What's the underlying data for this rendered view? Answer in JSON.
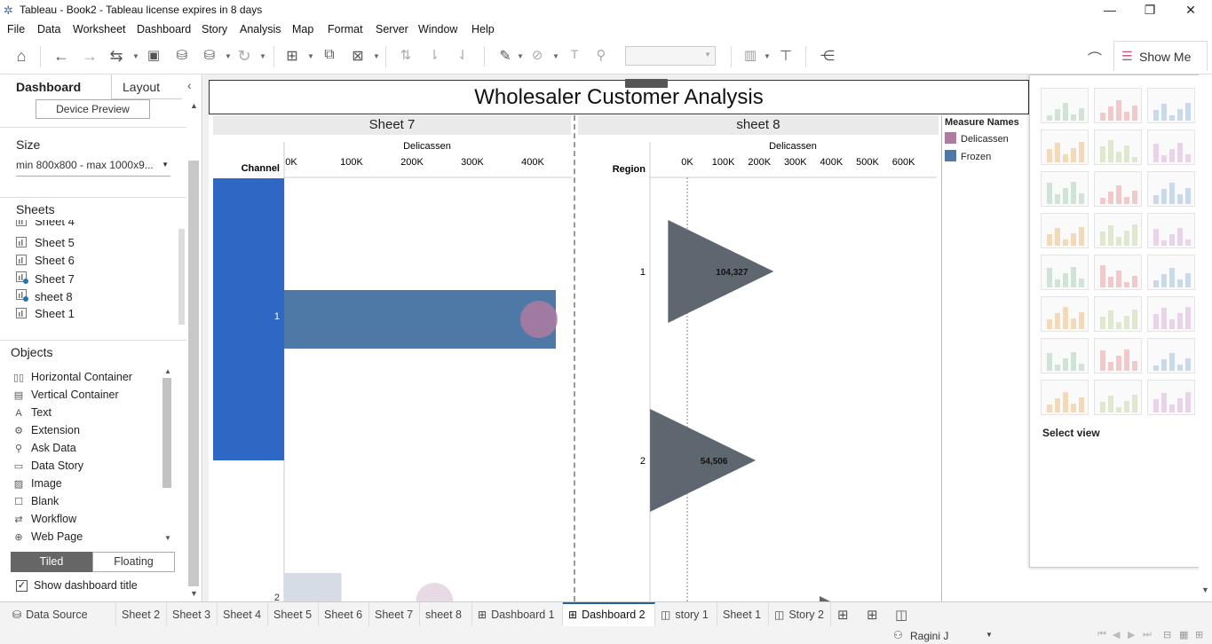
{
  "window": {
    "title": "Tableau - Book2 - Tableau license expires in 8 days",
    "min": "—",
    "max": "❐",
    "close": "✕"
  },
  "menu": [
    "File",
    "Data",
    "Worksheet",
    "Dashboard",
    "Story",
    "Analysis",
    "Map",
    "Format",
    "Server",
    "Window",
    "Help"
  ],
  "toolbar": {
    "show_me_label": "Show Me"
  },
  "left_panel": {
    "tabs": {
      "dashboard": "Dashboard",
      "layout": "Layout"
    },
    "device_preview": "Device Preview",
    "size_title": "Size",
    "size_value": "min 800x800 - max 1000x9...",
    "sheets_title": "Sheets",
    "sheets": [
      "Sheet 4",
      "Sheet 5",
      "Sheet 6",
      "Sheet 7",
      "sheet 8",
      "Sheet 1"
    ],
    "objects_title": "Objects",
    "objects": [
      {
        "label": "Horizontal Container",
        "icon": "horizontal-container-icon",
        "glyph": "▯▯"
      },
      {
        "label": "Vertical Container",
        "icon": "vertical-container-icon",
        "glyph": "▤"
      },
      {
        "label": "Text",
        "icon": "text-icon",
        "glyph": "A"
      },
      {
        "label": "Extension",
        "icon": "extension-icon",
        "glyph": "⚙"
      },
      {
        "label": "Ask Data",
        "icon": "ask-data-icon",
        "glyph": "⚲"
      },
      {
        "label": "Data Story",
        "icon": "data-story-icon",
        "glyph": "▭"
      },
      {
        "label": "Image",
        "icon": "image-icon",
        "glyph": "▨"
      },
      {
        "label": "Blank",
        "icon": "blank-icon",
        "glyph": "☐"
      },
      {
        "label": "Workflow",
        "icon": "workflow-icon",
        "glyph": "⇄"
      },
      {
        "label": "Web Page",
        "icon": "web-page-icon",
        "glyph": "⊕"
      }
    ],
    "tiled": "Tiled",
    "floating": "Floating",
    "show_title": "Show dashboard title"
  },
  "dashboard": {
    "title": "Wholesaler Customer Analysis",
    "sheet7": {
      "header": "Sheet 7",
      "measure": "Delicassen",
      "dim": "Channel",
      "ticks": [
        "0K",
        "100K",
        "200K",
        "300K",
        "400K"
      ],
      "rows": [
        "1",
        "2"
      ]
    },
    "sheet8": {
      "header": "sheet 8",
      "measure": "Delicassen",
      "dim": "Region",
      "ticks": [
        "0K",
        "100K",
        "200K",
        "300K",
        "400K",
        "500K",
        "600K"
      ],
      "rows": [
        "1",
        "2"
      ]
    },
    "legend": {
      "title": "Measure Names",
      "items": [
        "Delicassen",
        "Frozen"
      ]
    }
  },
  "chart_data": [
    {
      "type": "bar",
      "xlabel": "Delicassen",
      "ylabel": "Channel",
      "categories": [
        "1",
        "2"
      ],
      "xlim": [
        0,
        470000
      ],
      "series": [
        {
          "name": "Frozen",
          "values": [
            450000,
            95000
          ]
        },
        {
          "name": "Delicassen",
          "values": [
            421955,
            248988
          ]
        }
      ],
      "colors": {
        "Frozen": "#4e79a7",
        "Delicassen": "#b07aa1"
      }
    },
    {
      "type": "scatter",
      "xlabel": "Delicassen",
      "ylabel": "Region",
      "categories": [
        "1",
        "2"
      ],
      "xlim": [
        -100000,
        680000
      ],
      "values": [
        104327,
        54506
      ],
      "data_labels": [
        "104,327",
        "54,506"
      ]
    }
  ],
  "showme": {
    "hint": "Select view"
  },
  "bottom_tabs": [
    {
      "label": "Data Source",
      "icon": "database-icon",
      "glyph": "⛁"
    },
    {
      "label": "Sheet 2"
    },
    {
      "label": "Sheet 3"
    },
    {
      "label": "Sheet 4"
    },
    {
      "label": "Sheet 5"
    },
    {
      "label": "Sheet 6"
    },
    {
      "label": "Sheet 7"
    },
    {
      "label": "sheet 8"
    },
    {
      "label": "Dashboard 1",
      "icon": "dashboard-icon",
      "glyph": "⊞"
    },
    {
      "label": "Dashboard 2",
      "icon": "dashboard-icon",
      "glyph": "⊞",
      "active": true
    },
    {
      "label": "story 1",
      "icon": "story-icon",
      "glyph": "◫"
    },
    {
      "label": "Sheet 1"
    },
    {
      "label": "Story 2",
      "icon": "story-icon",
      "glyph": "◫"
    }
  ],
  "status": {
    "user": "Ragini J"
  }
}
